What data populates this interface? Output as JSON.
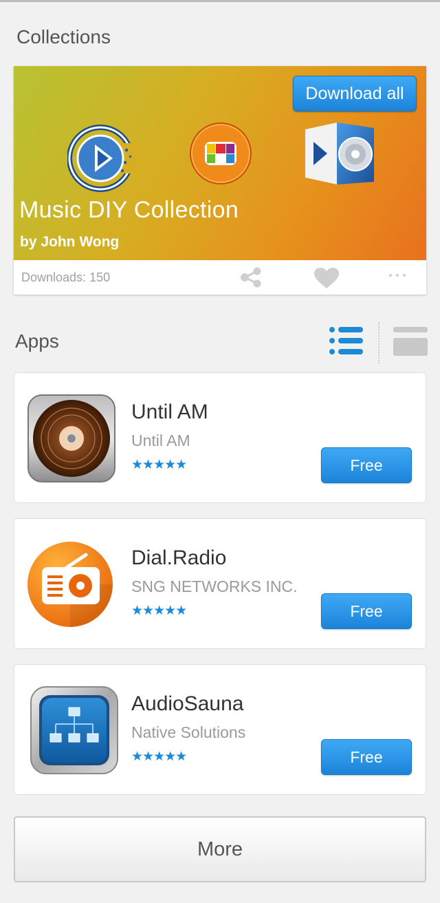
{
  "collections": {
    "title": "Collections",
    "card": {
      "name": "Music DIY Collection",
      "author": "by John Wong",
      "download_all_label": "Download all",
      "downloads": "Downloads: 150",
      "banner_icons": [
        "media-player-icon",
        "tv-camera-icon",
        "video-speaker-icon"
      ]
    }
  },
  "apps": {
    "title": "Apps",
    "view_toggles": [
      "list-view-icon",
      "grid-view-icon"
    ],
    "items": [
      {
        "name": "Until AM",
        "developer": "Until AM",
        "stars": "★★★★★",
        "rating": 5,
        "button": "Free",
        "icon": "vinyl-record-icon"
      },
      {
        "name": "Dial.Radio",
        "developer": "SNG NETWORKS INC.",
        "stars": "★★★★★",
        "rating": 5,
        "button": "Free",
        "icon": "radio-icon"
      },
      {
        "name": "AudioSauna",
        "developer": "Native Solutions",
        "stars": "★★★★★",
        "rating": 5,
        "button": "Free",
        "icon": "flowchart-icon"
      }
    ]
  },
  "more_label": "More",
  "colors": {
    "accent": "#1b84da",
    "star": "#1c8ad7",
    "background": "#f1f1f1"
  }
}
